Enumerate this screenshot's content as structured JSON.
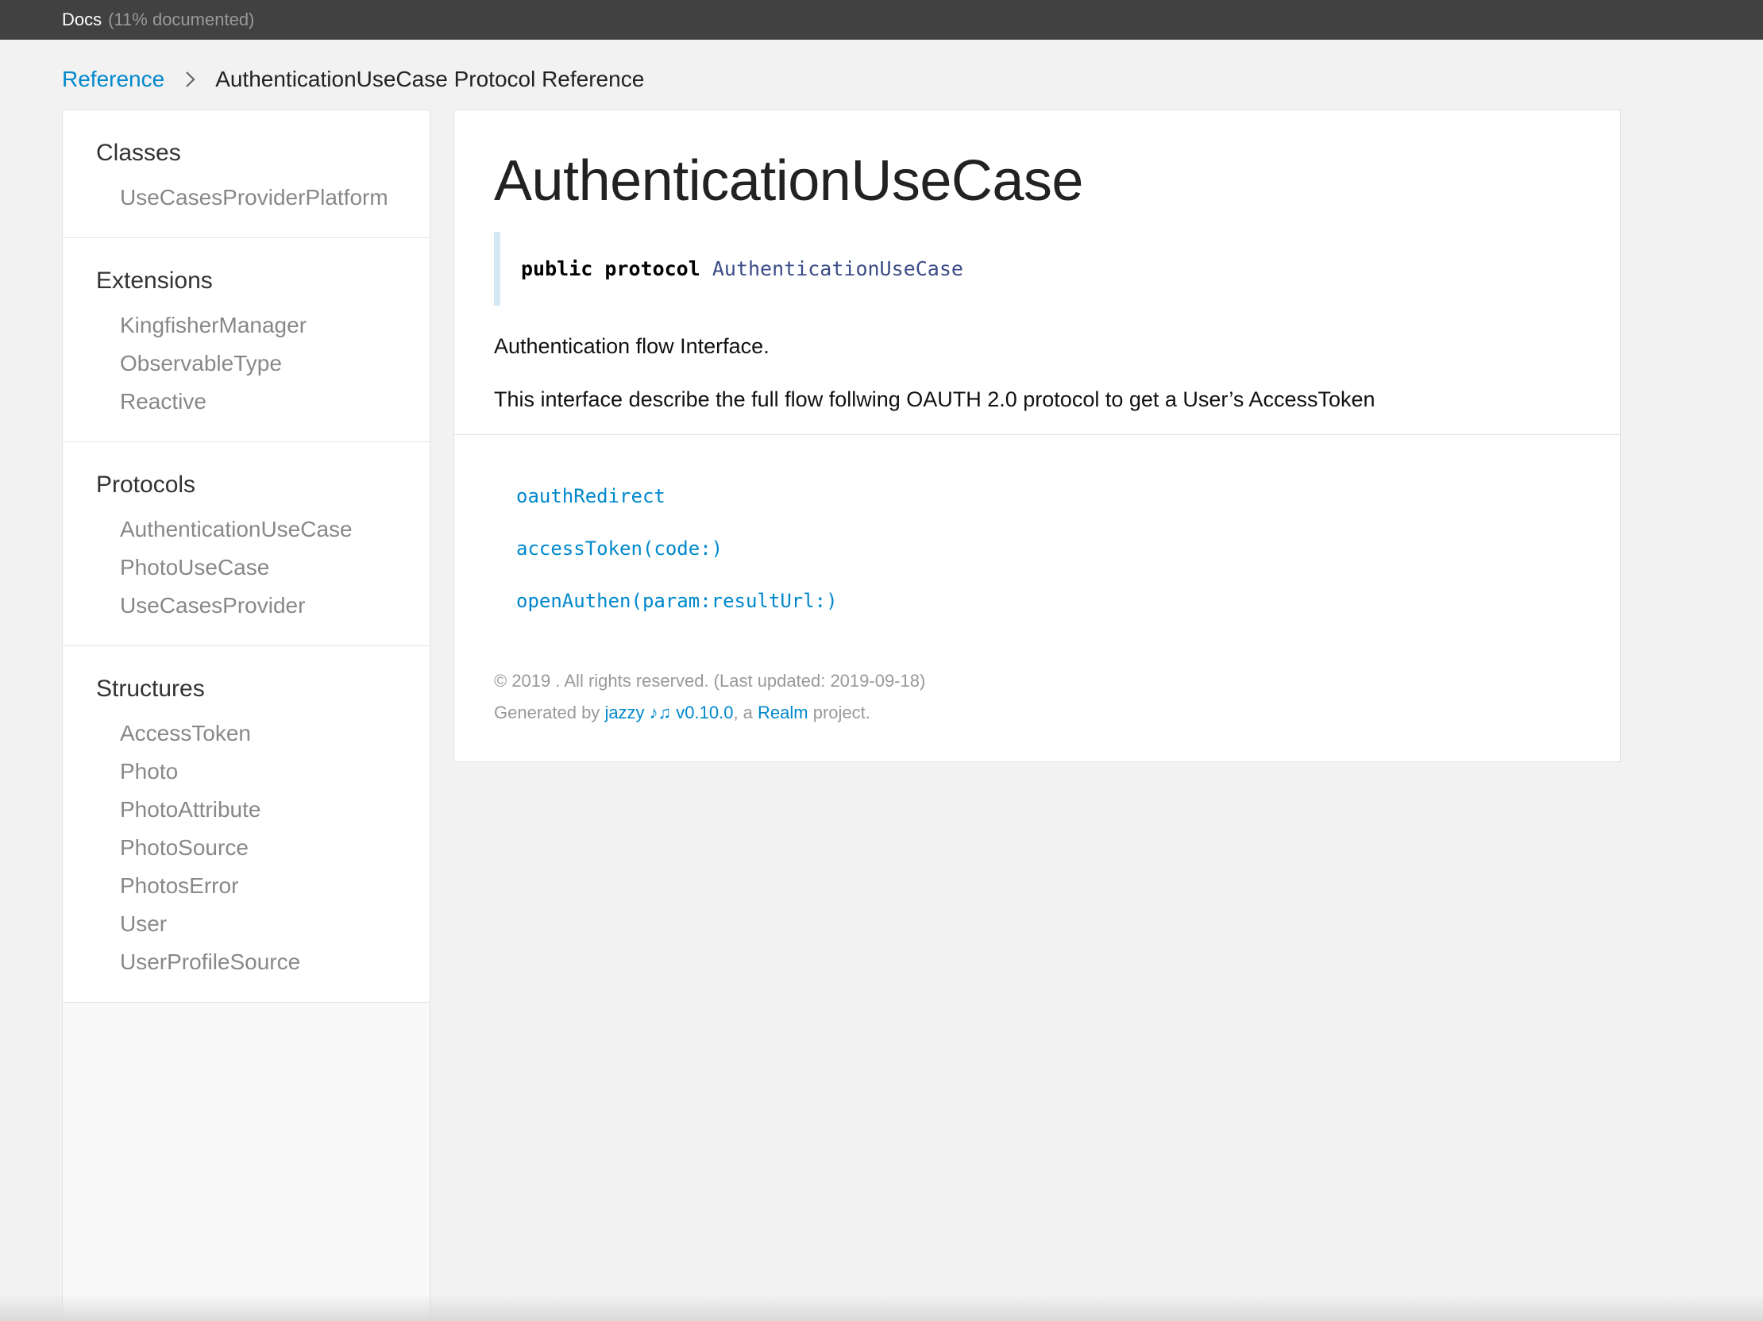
{
  "header": {
    "docs_title": "Docs",
    "coverage": "(11% documented)"
  },
  "breadcrumb": {
    "root": "Reference",
    "current": "AuthenticationUseCase Protocol Reference",
    "separator_icon": "chevron-right-icon"
  },
  "sidebar": {
    "groups": [
      {
        "name": "Classes",
        "items": [
          "UseCasesProviderPlatform"
        ]
      },
      {
        "name": "Extensions",
        "items": [
          "KingfisherManager",
          "ObservableType",
          "Reactive"
        ]
      },
      {
        "name": "Protocols",
        "items": [
          "AuthenticationUseCase",
          "PhotoUseCase",
          "UseCasesProvider"
        ]
      },
      {
        "name": "Structures",
        "items": [
          "AccessToken",
          "Photo",
          "PhotoAttribute",
          "PhotoSource",
          "PhotosError",
          "User",
          "UserProfileSource"
        ]
      }
    ]
  },
  "main": {
    "heading": "AuthenticationUseCase",
    "declaration": {
      "keyword": "public protocol",
      "type_name": "AuthenticationUseCase"
    },
    "abstract": [
      "Authentication flow Interface.",
      "This interface describe the full flow follwing OAUTH 2.0 protocol to get a User’s AccessToken"
    ],
    "tasks": [
      "oauthRedirect",
      "accessToken(code:)",
      "openAuthen(param:resultUrl:)"
    ],
    "footer": {
      "copyright": "© 2019 . All rights reserved. (Last updated: 2019-09-18)",
      "generated_prefix": "Generated by",
      "jazzy_link": "jazzy ♪♫ v0.10.0",
      "middle": ", a",
      "realm_link": "Realm",
      "suffix": "project."
    }
  },
  "colors": {
    "header_bg": "#414141",
    "link": "#0088cc",
    "declaration_bar": "#d4e8f3",
    "nav_item": "#888888"
  }
}
